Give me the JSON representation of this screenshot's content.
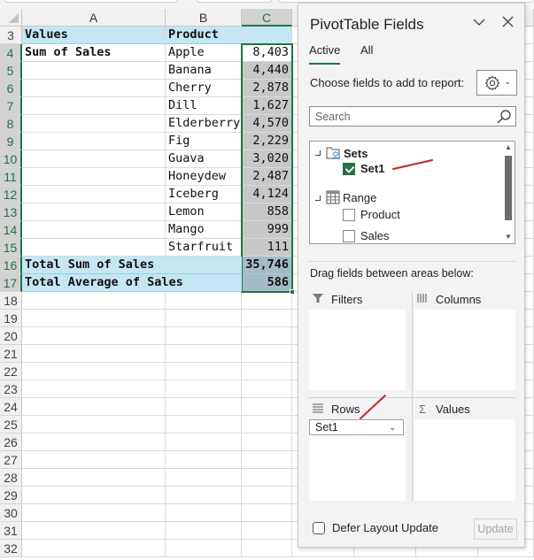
{
  "spreadsheet": {
    "columns": [
      {
        "label": "A",
        "selected": false
      },
      {
        "label": "B",
        "selected": false
      },
      {
        "label": "C",
        "selected": true
      }
    ],
    "rows": [
      {
        "num": "3",
        "a": "Values",
        "b": "Product",
        "c": "",
        "style": "header"
      },
      {
        "num": "4",
        "a": "Sum of Sales",
        "b": "Apple",
        "c": "8,403",
        "style": "data"
      },
      {
        "num": "5",
        "a": "",
        "b": "Banana",
        "c": "4,440",
        "style": "data"
      },
      {
        "num": "6",
        "a": "",
        "b": "Cherry",
        "c": "2,878",
        "style": "data"
      },
      {
        "num": "7",
        "a": "",
        "b": "Dill",
        "c": "1,627",
        "style": "data"
      },
      {
        "num": "8",
        "a": "",
        "b": "Elderberry",
        "c": "4,570",
        "style": "data"
      },
      {
        "num": "9",
        "a": "",
        "b": "Fig",
        "c": "2,229",
        "style": "data"
      },
      {
        "num": "10",
        "a": "",
        "b": "Guava",
        "c": "3,020",
        "style": "data"
      },
      {
        "num": "11",
        "a": "",
        "b": "Honeydew",
        "c": "2,487",
        "style": "data"
      },
      {
        "num": "12",
        "a": "",
        "b": "Iceberg",
        "c": "4,124",
        "style": "data"
      },
      {
        "num": "13",
        "a": "",
        "b": "Lemon",
        "c": "858",
        "style": "data"
      },
      {
        "num": "14",
        "a": "",
        "b": "Mango",
        "c": "999",
        "style": "data"
      },
      {
        "num": "15",
        "a": "",
        "b": "Starfruit",
        "c": "111",
        "style": "data"
      },
      {
        "num": "16",
        "a": "Total Sum of Sales",
        "b": "",
        "c": "35,746",
        "style": "total"
      },
      {
        "num": "17",
        "a": "Total Average of Sales",
        "b": "",
        "c": "586",
        "style": "total"
      },
      {
        "num": "18",
        "a": "",
        "b": "",
        "c": "",
        "style": "empty"
      },
      {
        "num": "19",
        "a": "",
        "b": "",
        "c": "",
        "style": "empty"
      },
      {
        "num": "20",
        "a": "",
        "b": "",
        "c": "",
        "style": "empty"
      },
      {
        "num": "21",
        "a": "",
        "b": "",
        "c": "",
        "style": "empty"
      },
      {
        "num": "22",
        "a": "",
        "b": "",
        "c": "",
        "style": "empty"
      },
      {
        "num": "23",
        "a": "",
        "b": "",
        "c": "",
        "style": "empty"
      },
      {
        "num": "24",
        "a": "",
        "b": "",
        "c": "",
        "style": "empty"
      },
      {
        "num": "25",
        "a": "",
        "b": "",
        "c": "",
        "style": "empty"
      },
      {
        "num": "26",
        "a": "",
        "b": "",
        "c": "",
        "style": "empty"
      },
      {
        "num": "27",
        "a": "",
        "b": "",
        "c": "",
        "style": "empty"
      },
      {
        "num": "28",
        "a": "",
        "b": "",
        "c": "",
        "style": "empty"
      },
      {
        "num": "29",
        "a": "",
        "b": "",
        "c": "",
        "style": "empty"
      },
      {
        "num": "30",
        "a": "",
        "b": "",
        "c": "",
        "style": "empty"
      },
      {
        "num": "31",
        "a": "",
        "b": "",
        "c": "",
        "style": "empty"
      },
      {
        "num": "32",
        "a": "",
        "b": "",
        "c": "",
        "style": "empty"
      }
    ],
    "selection": "C4:C17",
    "accent_color": "#217346",
    "pivot_header_fill": "#c5e6f3"
  },
  "pivot_panel": {
    "title": "PivotTable Fields",
    "collapse_icon": "chevron-down-icon",
    "close_icon": "close-icon",
    "tabs": [
      {
        "label": "Active",
        "active": true
      },
      {
        "label": "All",
        "active": false
      }
    ],
    "choose_label": "Choose fields to add to report:",
    "settings_icon": "gear-icon",
    "search": {
      "placeholder": "Search",
      "value": ""
    },
    "field_groups": [
      {
        "label": "Sets",
        "icon": "sets-icon",
        "bold": true,
        "fields": [
          {
            "label": "Set1",
            "checked": true,
            "bold": true
          }
        ]
      },
      {
        "label": "Range",
        "icon": "table-icon",
        "bold": false,
        "fields": [
          {
            "label": "Product",
            "checked": false,
            "bold": false
          },
          {
            "label": "Sales",
            "checked": false,
            "bold": false
          }
        ]
      }
    ],
    "drag_label": "Drag fields between areas below:",
    "areas": {
      "filters": {
        "label": "Filters",
        "icon": "filter-icon",
        "items": []
      },
      "columns": {
        "label": "Columns",
        "icon": "columns-icon",
        "items": []
      },
      "rows": {
        "label": "Rows",
        "icon": "rows-icon",
        "items": [
          "Set1"
        ]
      },
      "values": {
        "label": "Values",
        "icon": "sigma-icon",
        "symbol": "Σ",
        "items": []
      }
    },
    "defer_label": "Defer Layout Update",
    "defer_checked": false,
    "update_label": "Update",
    "update_enabled": false
  }
}
